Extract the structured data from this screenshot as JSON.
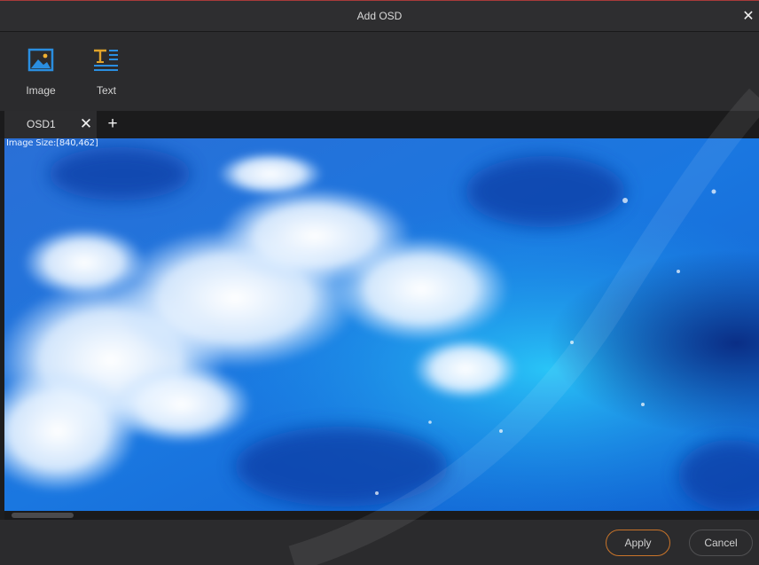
{
  "window": {
    "title": "Add OSD",
    "close_glyph": "✕"
  },
  "toolbar": {
    "tools": [
      {
        "label": "Image",
        "icon": "image-icon"
      },
      {
        "label": "Text",
        "icon": "text-icon"
      }
    ]
  },
  "tabs": {
    "items": [
      {
        "label": "OSD1",
        "close_glyph": "✕"
      }
    ],
    "add_glyph": "+"
  },
  "canvas": {
    "image_size_text": "Image Size:[840,462]"
  },
  "footer": {
    "apply_label": "Apply",
    "cancel_label": "Cancel"
  },
  "colors": {
    "accent_apply_border": "#c9742a",
    "icon_blue": "#2a8ee0",
    "icon_gold": "#e0a32a"
  }
}
